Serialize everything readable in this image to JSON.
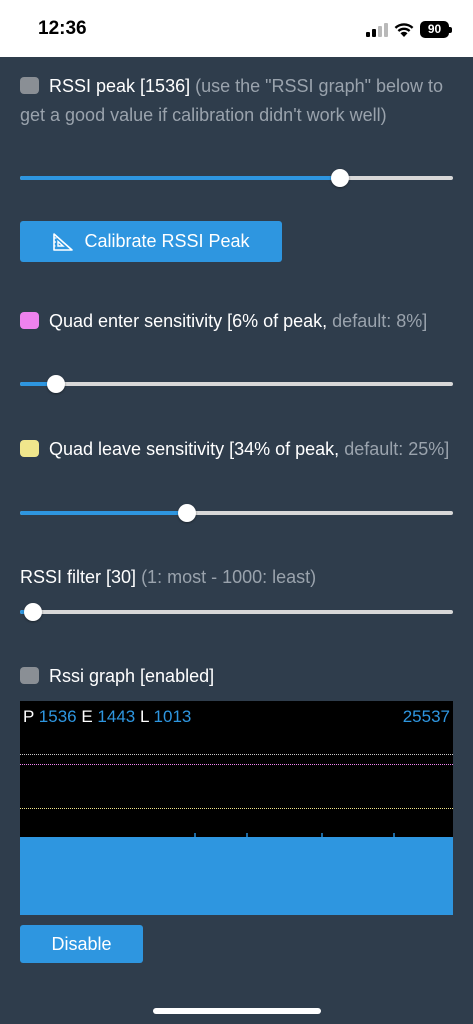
{
  "status_bar": {
    "time": "12:36",
    "battery": "90"
  },
  "rssi_peak": {
    "label": "RSSI peak [1536]",
    "hint": "(use the \"RSSI graph\" below to get a good value if calibration didn't work well)",
    "slider_fraction": 0.74
  },
  "calibrate_button": {
    "label": "Calibrate RSSI Peak",
    "icon": "set-square-icon"
  },
  "enter_sensitivity": {
    "label": "Quad enter sensitivity [6% of peak,",
    "default": "default: 8%]",
    "color": "#ee82ee",
    "slider_fraction": 0.083
  },
  "leave_sensitivity": {
    "label": "Quad leave sensitivity [34% of peak,",
    "default": "default: 25%]",
    "color": "#f0e68c",
    "slider_fraction": 0.385
  },
  "rssi_filter": {
    "label": "RSSI filter [30]",
    "hint": "(1: most - 1000: least)",
    "slider_fraction": 0.03
  },
  "rssi_graph": {
    "label": "Rssi graph [enabled]",
    "p_label": "P",
    "p_value": "1536",
    "e_label": "E",
    "e_value": "1443",
    "l_label": "L",
    "l_value": "1013",
    "count": "25537",
    "disable_label": "Disable"
  },
  "colors": {
    "accent": "#2e96e0",
    "background": "#2f3d4c"
  }
}
